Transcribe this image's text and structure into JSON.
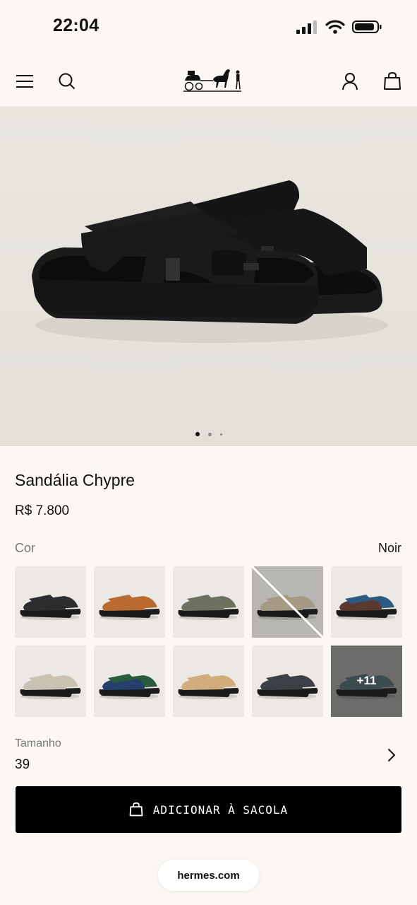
{
  "status_bar": {
    "time": "22:04"
  },
  "product": {
    "name": "Sandália Chypre",
    "price": "R$ 7.800"
  },
  "color": {
    "label": "Cor",
    "selected": "Noir",
    "swatches": [
      {
        "strap": "#2b2d2e",
        "selected": true
      },
      {
        "strap": "#b96a2e"
      },
      {
        "strap": "#6d7160"
      },
      {
        "strap": "#a59a85",
        "out_of_stock": true
      },
      {
        "strap": "#2d5a82",
        "strap2": "#5a3a30"
      },
      {
        "strap": "#c9c2b3"
      },
      {
        "strap": "#2a5b3c",
        "strap2": "#25406b"
      },
      {
        "strap": "#d1ad7e"
      },
      {
        "strap": "#3c3f46"
      },
      {
        "strap": "#3b4b4e",
        "more": "+11"
      }
    ]
  },
  "size": {
    "label": "Tamanho",
    "value": "39"
  },
  "cta": {
    "label": "ADICIONAR À SACOLA"
  },
  "browser": {
    "url": "hermes.com"
  },
  "icons": {
    "nav": [
      "menu-icon",
      "search-icon",
      "account-icon",
      "bag-icon"
    ],
    "status": [
      "signal-icon",
      "wifi-icon",
      "battery-icon"
    ]
  },
  "carousel": {
    "current": 1,
    "total": 3
  }
}
